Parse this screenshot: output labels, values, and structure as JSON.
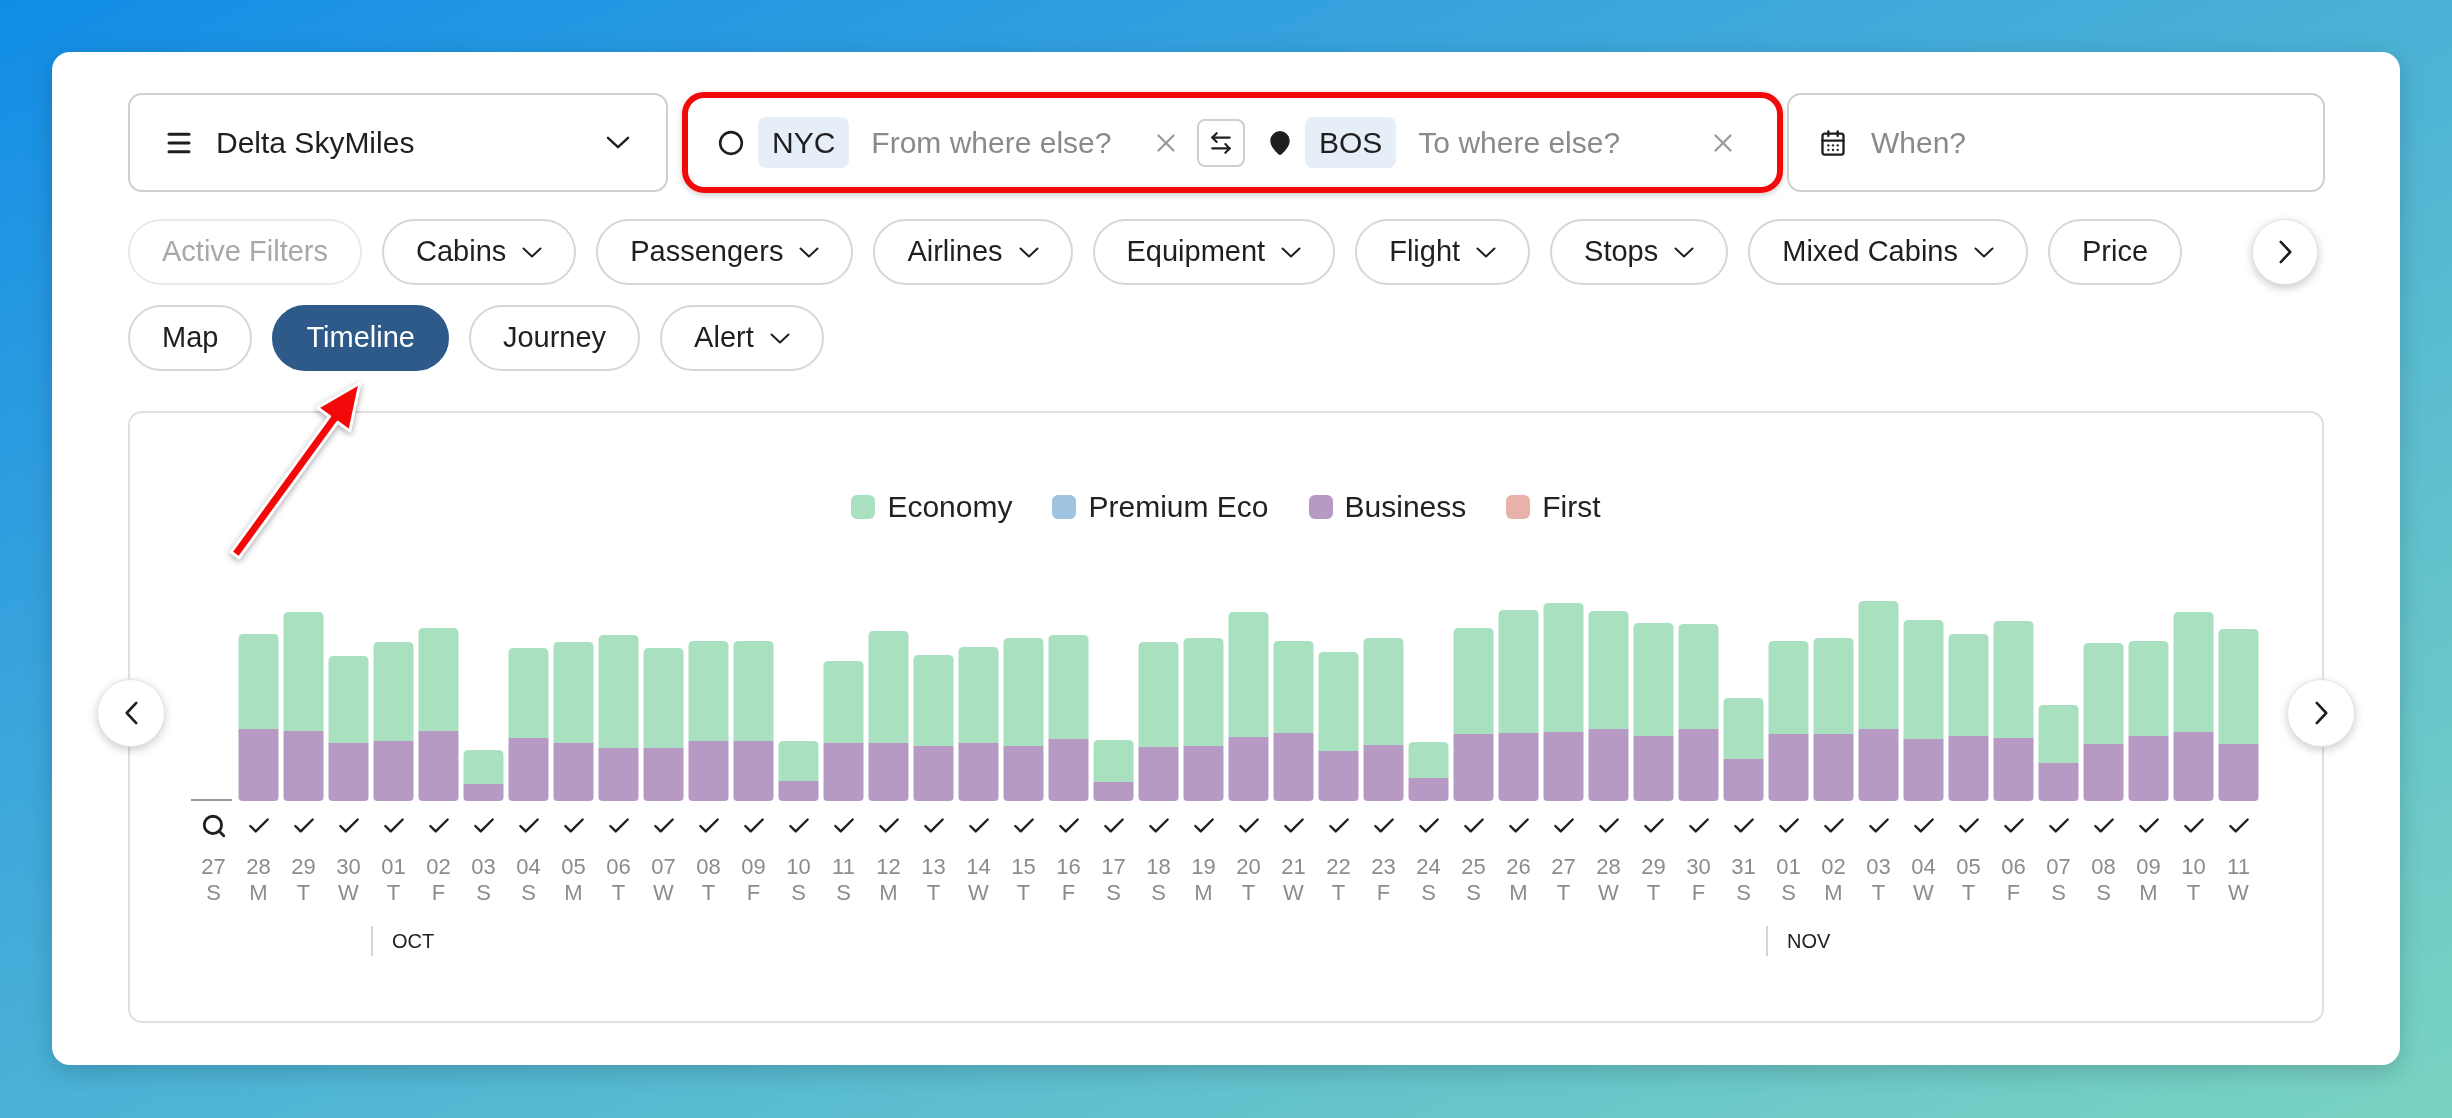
{
  "program_select": {
    "value": "Delta SkyMiles"
  },
  "route": {
    "origin": {
      "code": "NYC",
      "placeholder": "From where else?"
    },
    "destination": {
      "code": "BOS",
      "placeholder": "To where else?"
    }
  },
  "date_field": {
    "placeholder": "When?"
  },
  "filters": [
    {
      "label": "Active Filters",
      "disabled": true,
      "dropdown": false
    },
    {
      "label": "Cabins",
      "disabled": false,
      "dropdown": true
    },
    {
      "label": "Passengers",
      "disabled": false,
      "dropdown": true
    },
    {
      "label": "Airlines",
      "disabled": false,
      "dropdown": true
    },
    {
      "label": "Equipment",
      "disabled": false,
      "dropdown": true
    },
    {
      "label": "Flight",
      "disabled": false,
      "dropdown": true
    },
    {
      "label": "Stops",
      "disabled": false,
      "dropdown": true
    },
    {
      "label": "Mixed Cabins",
      "disabled": false,
      "dropdown": true
    },
    {
      "label": "Price",
      "disabled": false,
      "dropdown": false
    }
  ],
  "views": [
    {
      "label": "Map",
      "selected": false,
      "dropdown": false
    },
    {
      "label": "Timeline",
      "selected": true,
      "dropdown": false
    },
    {
      "label": "Journey",
      "selected": false,
      "dropdown": false
    },
    {
      "label": "Alert",
      "selected": false,
      "dropdown": true
    }
  ],
  "timeline": {
    "legend": [
      {
        "label": "Economy",
        "color": "#a8e0c0"
      },
      {
        "label": "Premium Eco",
        "color": "#9ec4df"
      },
      {
        "label": "Business",
        "color": "#b79ac4"
      },
      {
        "label": "First",
        "color": "#e8b2ab"
      }
    ],
    "days": [
      {
        "date": "27",
        "weekday": "S",
        "kind": "search"
      },
      {
        "date": "28",
        "weekday": "M",
        "kind": "check"
      },
      {
        "date": "29",
        "weekday": "T",
        "kind": "check"
      },
      {
        "date": "30",
        "weekday": "W",
        "kind": "check"
      },
      {
        "date": "01",
        "weekday": "T",
        "kind": "check",
        "month": "OCT"
      },
      {
        "date": "02",
        "weekday": "F",
        "kind": "check"
      },
      {
        "date": "03",
        "weekday": "S",
        "kind": "check"
      },
      {
        "date": "04",
        "weekday": "S",
        "kind": "check"
      },
      {
        "date": "05",
        "weekday": "M",
        "kind": "check"
      },
      {
        "date": "06",
        "weekday": "T",
        "kind": "check"
      },
      {
        "date": "07",
        "weekday": "W",
        "kind": "check"
      },
      {
        "date": "08",
        "weekday": "T",
        "kind": "check"
      },
      {
        "date": "09",
        "weekday": "F",
        "kind": "check"
      },
      {
        "date": "10",
        "weekday": "S",
        "kind": "check"
      },
      {
        "date": "11",
        "weekday": "S",
        "kind": "check"
      },
      {
        "date": "12",
        "weekday": "M",
        "kind": "check"
      },
      {
        "date": "13",
        "weekday": "T",
        "kind": "check"
      },
      {
        "date": "14",
        "weekday": "W",
        "kind": "check"
      },
      {
        "date": "15",
        "weekday": "T",
        "kind": "check"
      },
      {
        "date": "16",
        "weekday": "F",
        "kind": "check"
      },
      {
        "date": "17",
        "weekday": "S",
        "kind": "check"
      },
      {
        "date": "18",
        "weekday": "S",
        "kind": "check"
      },
      {
        "date": "19",
        "weekday": "M",
        "kind": "check"
      },
      {
        "date": "20",
        "weekday": "T",
        "kind": "check"
      },
      {
        "date": "21",
        "weekday": "W",
        "kind": "check"
      },
      {
        "date": "22",
        "weekday": "T",
        "kind": "check"
      },
      {
        "date": "23",
        "weekday": "F",
        "kind": "check"
      },
      {
        "date": "24",
        "weekday": "S",
        "kind": "check"
      },
      {
        "date": "25",
        "weekday": "S",
        "kind": "check"
      },
      {
        "date": "26",
        "weekday": "M",
        "kind": "check"
      },
      {
        "date": "27",
        "weekday": "T",
        "kind": "check"
      },
      {
        "date": "28",
        "weekday": "W",
        "kind": "check"
      },
      {
        "date": "29",
        "weekday": "T",
        "kind": "check"
      },
      {
        "date": "30",
        "weekday": "F",
        "kind": "check"
      },
      {
        "date": "31",
        "weekday": "S",
        "kind": "check"
      },
      {
        "date": "01",
        "weekday": "S",
        "kind": "check",
        "month": "NOV"
      },
      {
        "date": "02",
        "weekday": "M",
        "kind": "check"
      },
      {
        "date": "03",
        "weekday": "T",
        "kind": "check"
      },
      {
        "date": "04",
        "weekday": "W",
        "kind": "check"
      },
      {
        "date": "05",
        "weekday": "T",
        "kind": "check"
      },
      {
        "date": "06",
        "weekday": "F",
        "kind": "check"
      },
      {
        "date": "07",
        "weekday": "S",
        "kind": "check"
      },
      {
        "date": "08",
        "weekday": "S",
        "kind": "check"
      },
      {
        "date": "09",
        "weekday": "M",
        "kind": "check"
      },
      {
        "date": "10",
        "weekday": "T",
        "kind": "check"
      },
      {
        "date": "11",
        "weekday": "W",
        "kind": "check"
      }
    ]
  }
}
